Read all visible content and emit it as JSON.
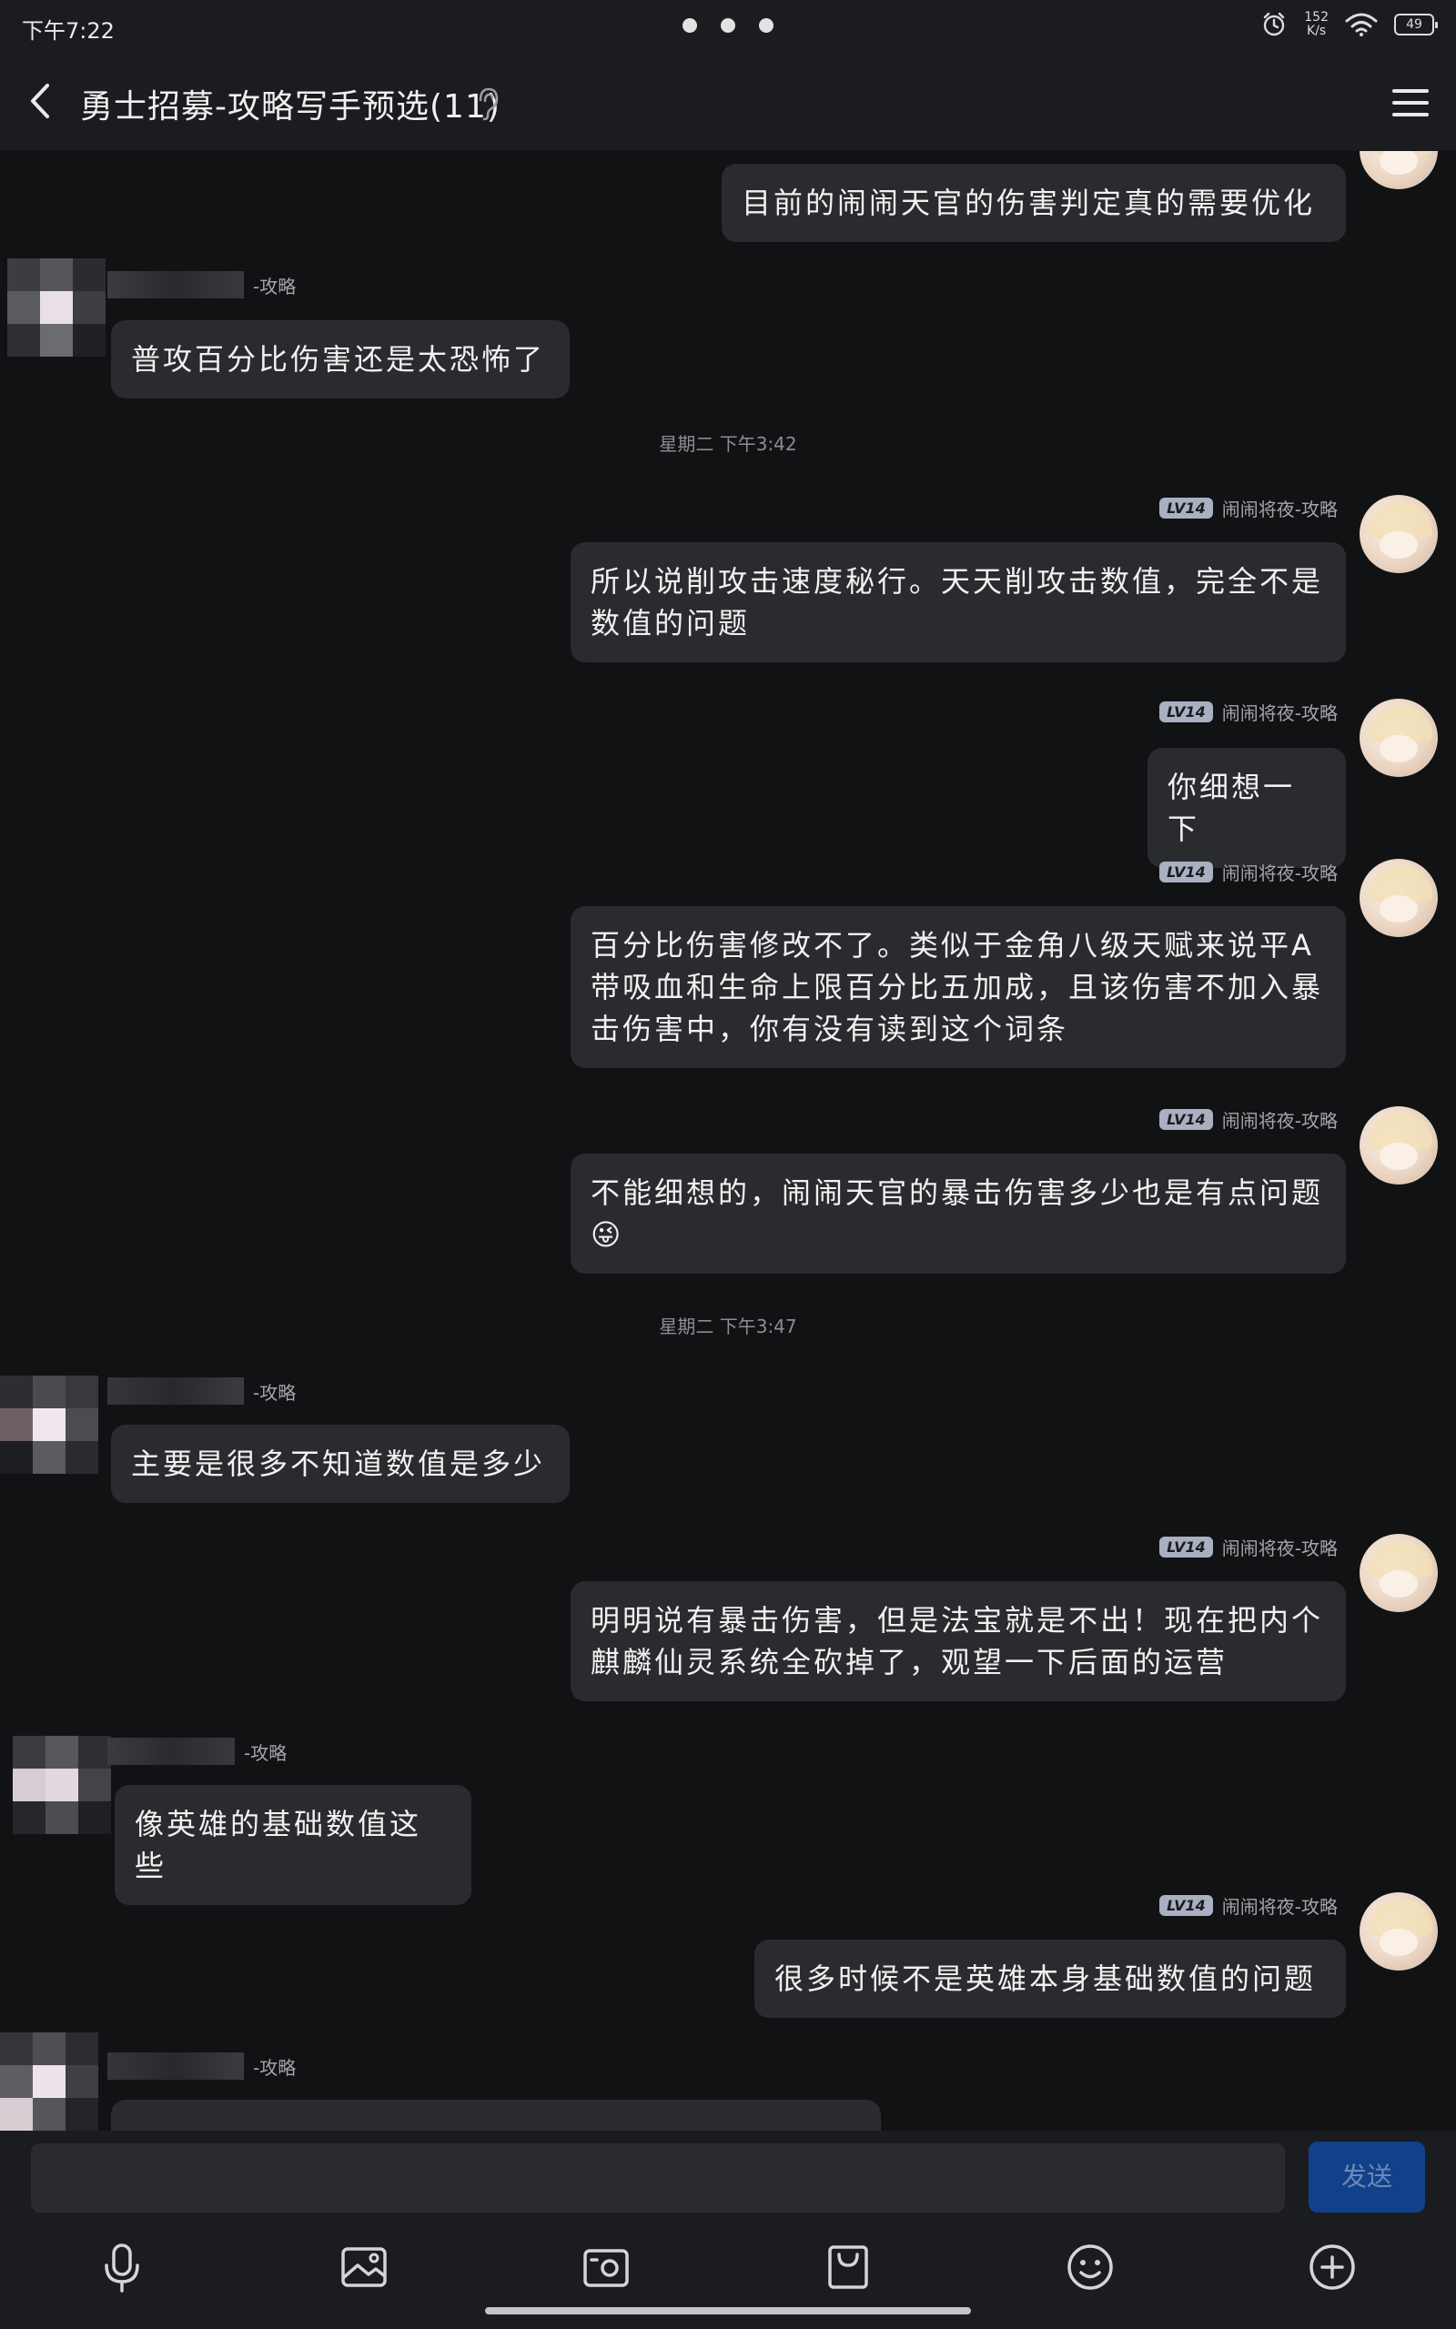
{
  "status_bar": {
    "time": "下午7:22",
    "net_speed_top": "152",
    "net_speed_bottom": "K/s",
    "battery": "49"
  },
  "header": {
    "title": "勇士招募-攻略写手预选(11)"
  },
  "self": {
    "level": "LV14",
    "name": "闹闹将夜-攻略"
  },
  "other": {
    "name_suffix": "-攻略"
  },
  "messages": {
    "m1": "目前的闹闹天官的伤害判定真的需要优化",
    "m2": "普攻百分比伤害还是太恐怖了",
    "ts1": "星期二 下午3:42",
    "m3": "所以说削攻击速度秘行。天天削攻击数值，完全不是数值的问题",
    "m4": "你细想一下",
    "m5": "百分比伤害修改不了。类似于金角八级天赋来说平A带吸血和生命上限百分比五加成，且该伤害不加入暴击伤害中，你有没有读到这个词条",
    "m6": "不能细想的，闹闹天官的暴击伤害多少也是有点问题",
    "m6_emoji": "😜",
    "ts2": "星期二 下午3:47",
    "m7": "主要是很多不知道数值是多少",
    "m8": "明明说有暴击伤害，但是法宝就是不出！现在把内个麒麟仙灵系统全砍掉了，观望一下后面的运营",
    "m9": "像英雄的基础数值这些",
    "m10": "很多时候不是英雄本身基础数值的问题"
  },
  "composer": {
    "input_value": "",
    "send_label": "发送"
  },
  "icons": {
    "back": "chevron-left-icon",
    "ear": "ear-icon",
    "menu": "hamburger-menu-icon",
    "tools": [
      "microphone-icon",
      "image-icon",
      "camera-icon",
      "shopping-bag-icon",
      "emoji-icon",
      "plus-circle-icon"
    ]
  },
  "colors": {
    "background": "#111214",
    "bubble": "#2a2b2e",
    "send_button": "#11418a",
    "level_badge": "#a9b0c2"
  }
}
